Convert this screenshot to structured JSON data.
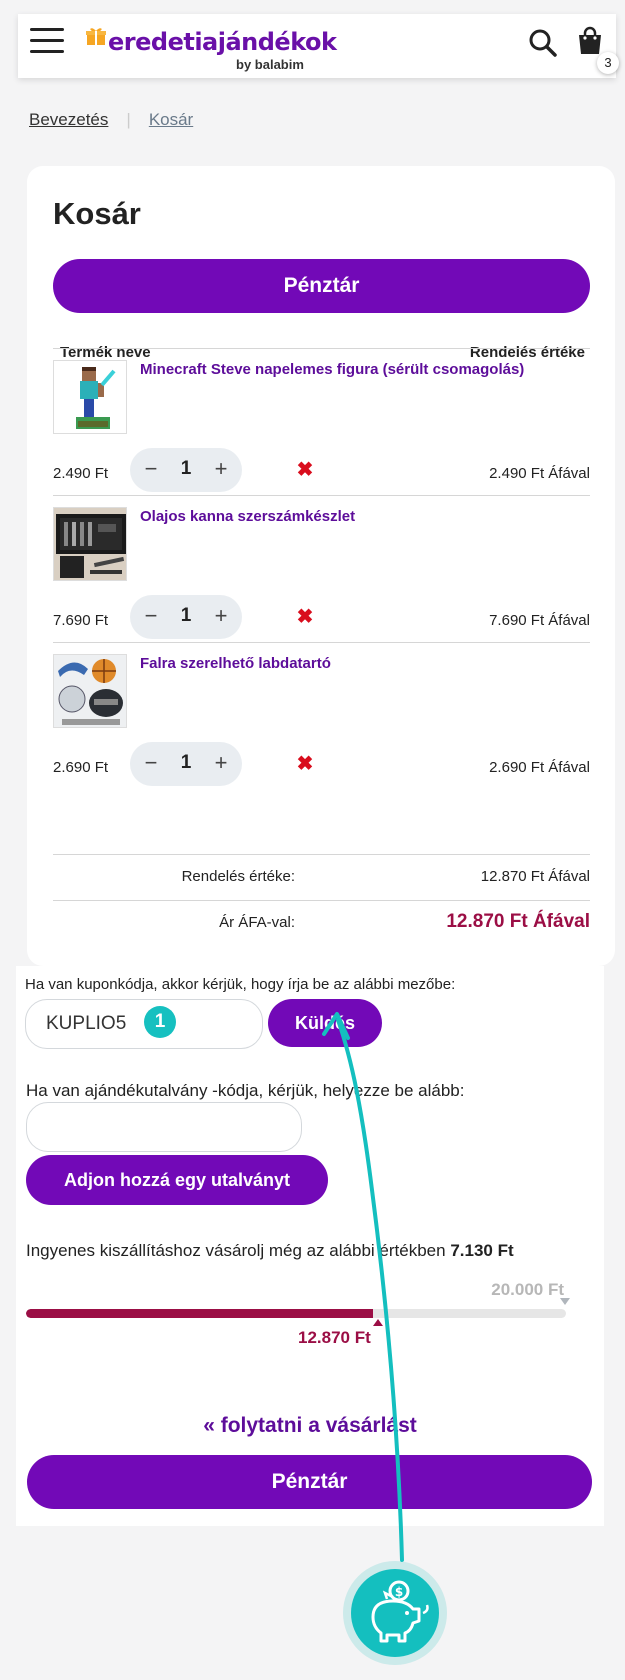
{
  "header": {
    "brand_name": "eredetiajándékok",
    "brand_sub": "by balabim",
    "cart_count": "3",
    "icons": {
      "menu": "hamburger-menu-icon",
      "search": "search-icon",
      "cart": "shopping-bag-icon",
      "logo": "gift-icon"
    }
  },
  "breadcrumb": {
    "home": "Bevezetés",
    "current": "Kosár"
  },
  "cart": {
    "title": "Kosár",
    "checkout_label": "Pénztár",
    "col_product": "Termék neve",
    "col_value": "Rendelés értéke",
    "items": [
      {
        "name": "Minecraft Steve napelemes figura (sérült csomagolás)",
        "unit_price": "2.490 Ft",
        "qty": "1",
        "total": "2.490 Ft Áfával"
      },
      {
        "name": "Olajos kanna szerszámkészlet",
        "unit_price": "7.690 Ft",
        "qty": "1",
        "total": "7.690 Ft Áfával"
      },
      {
        "name": "Falra szerelhető labdatartó",
        "unit_price": "2.690 Ft",
        "qty": "1",
        "total": "2.690 Ft Áfával"
      }
    ],
    "minus": "−",
    "plus": "+",
    "remove_symbol": "✖",
    "order_value_label": "Rendelés értéke:",
    "order_value": "12.870 Ft Áfával",
    "grand_label": "Ár ÁFA-val:",
    "grand_value": "12.870 Ft Áfával"
  },
  "coupon": {
    "hint": "Ha van kuponkódja, akkor kérjük, hogy írja be az alábbi mezőbe:",
    "value": "KUPLIO5",
    "badge": "1",
    "send_label": "Küldés"
  },
  "voucher": {
    "hint": "Ha van ajándékutalvány -kódja, kérjük, helyezze be alább:",
    "value": "",
    "button_label": "Adjon hozzá egy utalványt"
  },
  "shipping": {
    "text": "Ingyenes kiszállításhoz vásárolj még az alábbi értékben",
    "remaining": "7.130 Ft",
    "target": "20.000 Ft",
    "current": "12.870 Ft",
    "progress_fraction": 0.6435,
    "accent": "#9b0e45"
  },
  "footer": {
    "continue_label": "« folytatni a vásárlást",
    "checkout_label": "Pénztár"
  },
  "colors": {
    "primary": "#7209b7",
    "teal": "#14bfbf",
    "danger": "#d90d1d"
  },
  "floating": {
    "icon": "piggy-bank-coin-icon"
  }
}
